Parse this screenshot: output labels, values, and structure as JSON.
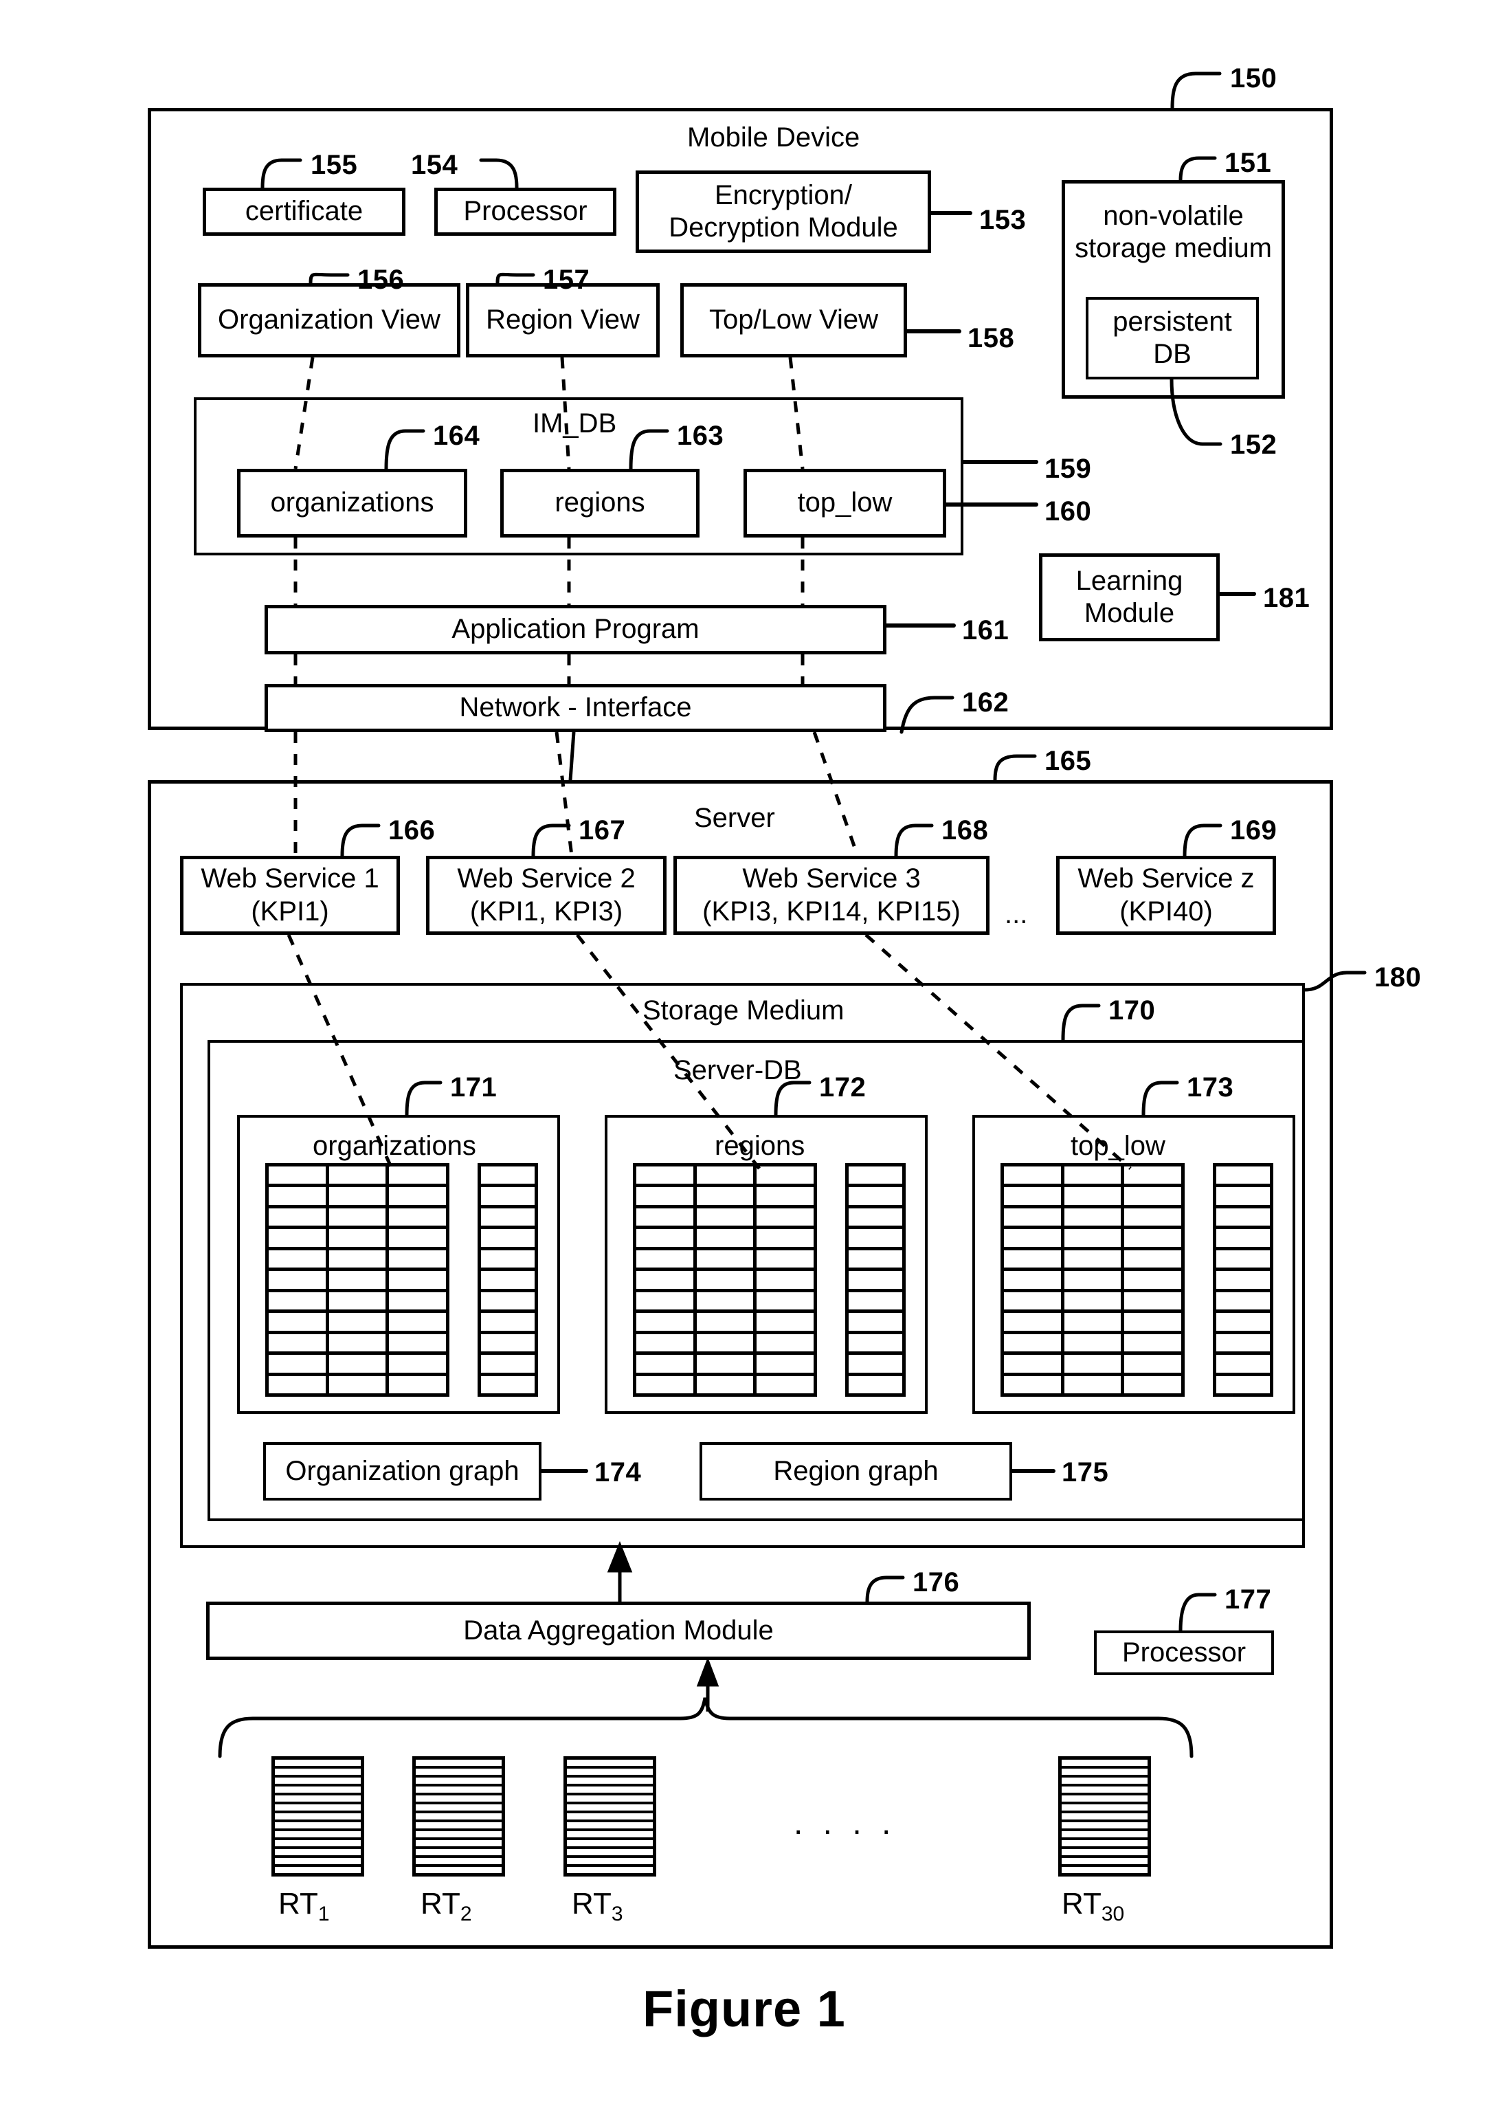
{
  "figure": {
    "caption": "Figure 1"
  },
  "mobile_device": {
    "title": "Mobile Device",
    "ref": "150",
    "certificate": {
      "label": "certificate",
      "ref": "155"
    },
    "processor": {
      "label": "Processor",
      "ref": "154"
    },
    "encryption_module": {
      "line1": "Encryption/",
      "line2": "Decryption Module",
      "ref": "153"
    },
    "nonvolatile_storage": {
      "line1": "non-volatile",
      "line2": "storage medium",
      "ref": "151"
    },
    "persistent_db": {
      "line1": "persistent",
      "line2": "DB",
      "ref": "152"
    },
    "organization_view": {
      "label": "Organization View",
      "ref": "156"
    },
    "region_view": {
      "label": "Region View",
      "ref": "157"
    },
    "toplow_view": {
      "label": "Top/Low View",
      "ref": "158"
    },
    "im_db": {
      "title": "IM_DB",
      "ref": "159"
    },
    "im_tables": [
      {
        "label": "organizations",
        "ref": "164"
      },
      {
        "label": "regions",
        "ref": "163"
      },
      {
        "label": "top_low",
        "ref": "160"
      }
    ],
    "application_program": {
      "label": "Application Program",
      "ref": "161"
    },
    "network_interface": {
      "label": "Network - Interface",
      "ref": "162"
    },
    "learning_module": {
      "line1": "Learning",
      "line2": "Module",
      "ref": "181"
    }
  },
  "server": {
    "title": "Server",
    "ref": "165",
    "outer_ref": "180",
    "web_services": [
      {
        "line1": "Web Service 1",
        "line2": "(KPI1)",
        "ref": "166"
      },
      {
        "line1": "Web Service 2",
        "line2": "(KPI1, KPI3)",
        "ref": "167"
      },
      {
        "line1": "Web Service 3",
        "line2": "(KPI3, KPI14, KPI15)",
        "ref": "168"
      },
      {
        "line1": "Web Service z",
        "line2": "(KPI40)",
        "ref": "169"
      }
    ],
    "web_services_ellipsis": "...",
    "storage_medium": {
      "title": "Storage Medium",
      "ref": "170"
    },
    "server_db": {
      "title": "Server-DB"
    },
    "db_tables": [
      {
        "label": "organizations",
        "ref": "171"
      },
      {
        "label": "regions",
        "ref": "172"
      },
      {
        "label": "top_low",
        "ref": "173"
      }
    ],
    "organization_graph": {
      "label": "Organization graph",
      "ref": "174"
    },
    "region_graph": {
      "label": "Region graph",
      "ref": "175"
    },
    "data_aggregation_module": {
      "label": "Data Aggregation Module",
      "ref": "176"
    },
    "processor": {
      "label": "Processor",
      "ref": "177"
    },
    "rt_units": [
      {
        "base": "RT",
        "sub": "1"
      },
      {
        "base": "RT",
        "sub": "2"
      },
      {
        "base": "RT",
        "sub": "3"
      },
      {
        "base": "RT",
        "sub": "30"
      }
    ],
    "rt_ellipsis": ". . . ."
  },
  "colors": {
    "stroke": "#000000",
    "background": "#ffffff"
  }
}
